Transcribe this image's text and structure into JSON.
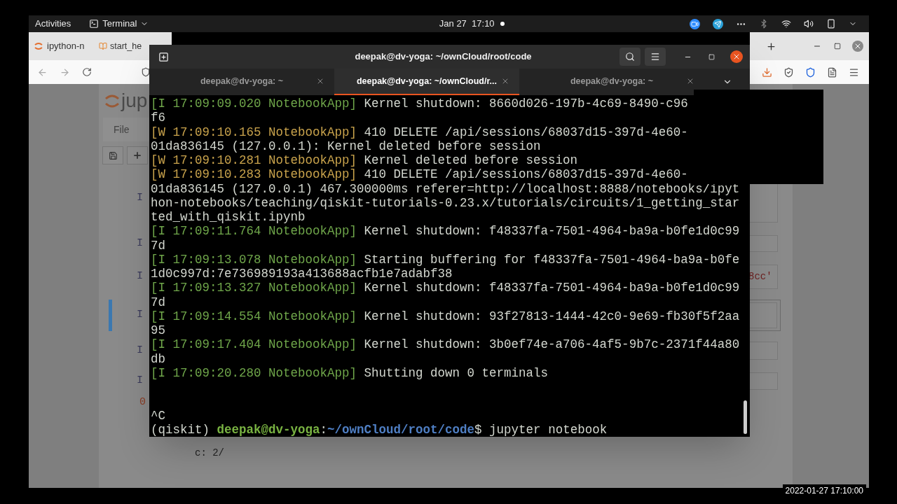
{
  "top_bar": {
    "activities": "Activities",
    "app_menu": "Terminal",
    "clock": "Jan 27  17:10"
  },
  "browser": {
    "tabs": [
      {
        "title": "ipython-n"
      },
      {
        "title": "start_he"
      }
    ],
    "page": {
      "logo": "jup",
      "menu": [
        "File"
      ],
      "cells": [
        {
          "prompt": "I",
          "selected": false
        },
        {
          "prompt": "I",
          "selected": false
        },
        {
          "prompt": "I",
          "selected": false,
          "text": "8cc'"
        },
        {
          "prompt": "I",
          "selected": true
        },
        {
          "prompt": "I",
          "selected": false
        },
        {
          "prompt": "I",
          "selected": false
        }
      ],
      "output_prompt": "0",
      "output_text": "c: 2/"
    }
  },
  "terminal": {
    "title": "deepak@dv-yoga: ~/ownCloud/root/code",
    "tabs": [
      {
        "label": "deepak@dv-yoga: ~",
        "selected": false
      },
      {
        "label": "deepak@dv-yoga: ~/ownCloud/r...",
        "selected": true
      },
      {
        "label": "deepak@dv-yoga: ~",
        "selected": false
      }
    ],
    "rows": [
      {
        "kind": "info",
        "tag": "[I 17:09:09.020 NotebookApp]",
        "text": " Kernel shutdown: 8660d026-197b-4c69-8490-c96"
      },
      {
        "kind": "text",
        "text": "f6"
      },
      {
        "kind": "warn",
        "tag": "[W 17:09:10.165 NotebookApp]",
        "text": " 410 DELETE /api/sessions/68037d15-397d-4e60-"
      },
      {
        "kind": "text",
        "text": "01da836145 (127.0.0.1): Kernel deleted before session"
      },
      {
        "kind": "warn",
        "tag": "[W 17:09:10.281 NotebookApp]",
        "text": " Kernel deleted before session"
      },
      {
        "kind": "warn",
        "tag": "[W 17:09:10.283 NotebookApp]",
        "text": " 410 DELETE /api/sessions/68037d15-397d-4e60-"
      },
      {
        "kind": "text",
        "text": "01da836145 (127.0.0.1) 467.300000ms referer=http://localhost:8888/notebooks/ipyt"
      },
      {
        "kind": "text",
        "text": "hon-notebooks/teaching/qiskit-tutorials-0.23.x/tutorials/circuits/1_getting_star"
      },
      {
        "kind": "text",
        "text": "ted_with_qiskit.ipynb"
      },
      {
        "kind": "info",
        "tag": "[I 17:09:11.764 NotebookApp]",
        "text": " Kernel shutdown: f48337fa-7501-4964-ba9a-b0fe1d0c99"
      },
      {
        "kind": "text",
        "text": "7d"
      },
      {
        "kind": "info",
        "tag": "[I 17:09:13.078 NotebookApp]",
        "text": " Starting buffering for f48337fa-7501-4964-ba9a-b0fe"
      },
      {
        "kind": "text",
        "text": "1d0c997d:7e736989193a413688acfb1e7adabf38"
      },
      {
        "kind": "info",
        "tag": "[I 17:09:13.327 NotebookApp]",
        "text": " Kernel shutdown: f48337fa-7501-4964-ba9a-b0fe1d0c99"
      },
      {
        "kind": "text",
        "text": "7d"
      },
      {
        "kind": "info",
        "tag": "[I 17:09:14.554 NotebookApp]",
        "text": " Kernel shutdown: 93f27813-1444-42c0-9e69-fb30f5f2aa"
      },
      {
        "kind": "text",
        "text": "95"
      },
      {
        "kind": "info",
        "tag": "[I 17:09:17.404 NotebookApp]",
        "text": " Kernel shutdown: 3b0ef74e-a706-4af5-9b7c-2371f44a80"
      },
      {
        "kind": "text",
        "text": "db"
      },
      {
        "kind": "info",
        "tag": "[I 17:09:20.280 NotebookApp]",
        "text": " Shutting down 0 terminals"
      },
      {
        "kind": "blank"
      },
      {
        "kind": "blank"
      },
      {
        "kind": "text",
        "text": "^C"
      }
    ],
    "prompt": [
      {
        "text": "(qiskit) ",
        "kind": "plain"
      },
      {
        "text": "deepak@dv-yoga",
        "kind": "user"
      },
      {
        "text": ":",
        "kind": "plain"
      },
      {
        "text": "~/ownCloud/root/code",
        "kind": "path"
      },
      {
        "text": "$ jupyter notebook",
        "kind": "plain"
      }
    ]
  },
  "recording_timestamp": "2022-01-27 17:10:00"
}
